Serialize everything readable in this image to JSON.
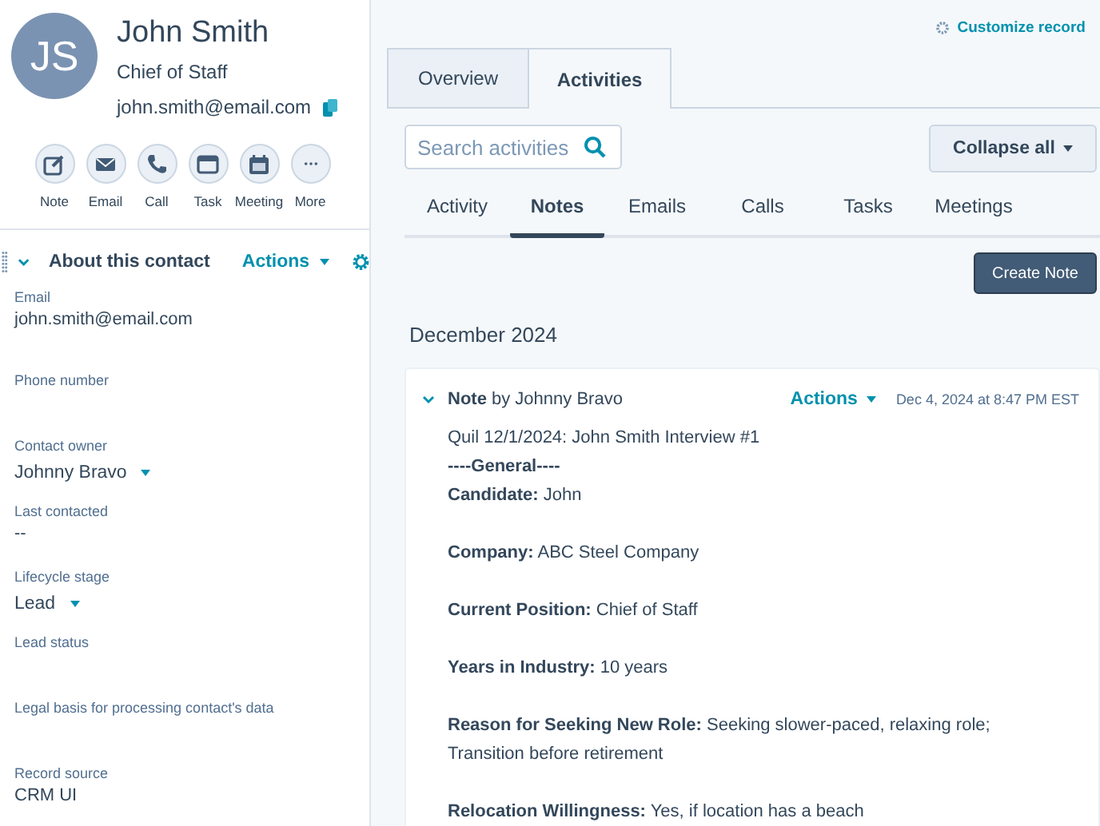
{
  "contact": {
    "initials": "JS",
    "name": "John Smith",
    "title": "Chief of Staff",
    "email": "john.smith@email.com"
  },
  "quick_actions": [
    {
      "kind": "note",
      "label": "Note"
    },
    {
      "kind": "email",
      "label": "Email"
    },
    {
      "kind": "call",
      "label": "Call"
    },
    {
      "kind": "task",
      "label": "Task"
    },
    {
      "kind": "meeting",
      "label": "Meeting"
    },
    {
      "kind": "more",
      "label": "More"
    }
  ],
  "about": {
    "title": "About this contact",
    "actions": "Actions",
    "expanded": true
  },
  "fields": [
    {
      "label": "Email",
      "value": "john.smith@email.com",
      "dropdown": false
    },
    {
      "label": "Phone number"
    },
    {
      "label": "Contact owner",
      "value": "Johnny Bravo",
      "dropdown": true
    },
    {
      "label": "Last contacted",
      "value": "--",
      "dropdown": false
    },
    {
      "label": "Lifecycle stage",
      "value": "Lead",
      "dropdown": true
    },
    {
      "label": "Lead status"
    },
    {
      "label": "Legal basis for processing contact's data"
    },
    {
      "label": "Record source",
      "value": "CRM UI",
      "dropdown": false
    }
  ],
  "customize_link": "Customize record",
  "tabs": [
    {
      "label": "Overview",
      "selected": false
    },
    {
      "label": "Activities",
      "selected": true
    }
  ],
  "search": {
    "placeholder": "Search activities"
  },
  "collapse_button": "Collapse all",
  "subtabs": [
    {
      "label": "Activity",
      "selected": false
    },
    {
      "label": "Notes",
      "selected": true
    },
    {
      "label": "Emails",
      "selected": false
    },
    {
      "label": "Calls",
      "selected": false
    },
    {
      "label": "Tasks",
      "selected": false
    },
    {
      "label": "Meetings",
      "selected": false
    }
  ],
  "create_button": "Create Note",
  "month": "December 2024",
  "note": {
    "expanded": true,
    "heading": "**Note** by Johnny Bravo",
    "actions": "Actions",
    "timestamp": "Dec 4, 2024 at 8:47 PM EST",
    "paragraphs": [
      [
        "Quil 12/1/2024: John Smith Interview #1",
        "**----General----**",
        "**Candidate:** John"
      ],
      [
        "**Company:** ABC Steel Company"
      ],
      [
        "**Current Position:** Chief of Staff"
      ],
      [
        "**Years in Industry:** 10 years"
      ],
      [
        "**Reason for Seeking New Role:** Seeking slower-paced, relaxing role; Transition before retirement"
      ],
      [
        "**Relocation Willingness:** Yes, if location has a beach"
      ]
    ]
  }
}
